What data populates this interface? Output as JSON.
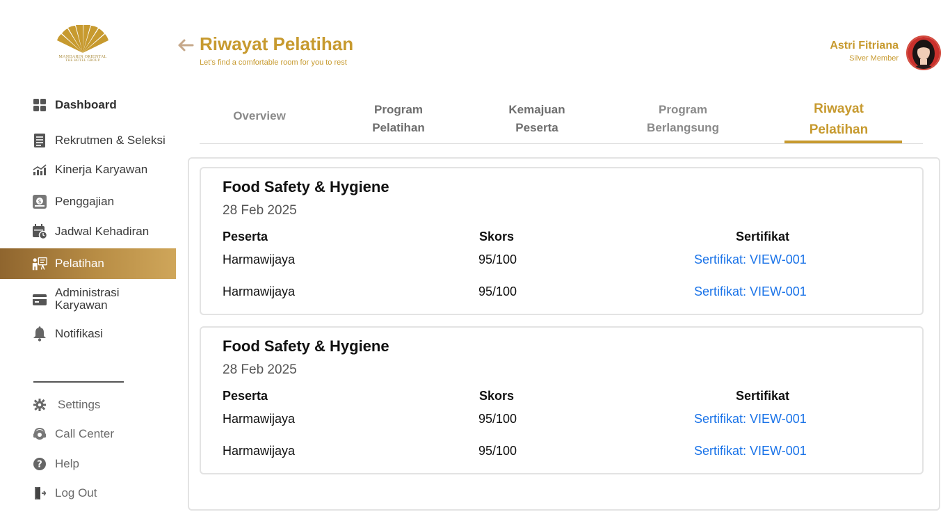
{
  "brand": {
    "line1": "MANDARIN ORIENTAL",
    "line2": "THE HOTEL GROUP",
    "color": "#c79a2f"
  },
  "sidebar": {
    "items": [
      {
        "label": "Dashboard",
        "icon": "grid-icon"
      },
      {
        "label": "Rekrutmen & Seleksi",
        "icon": "clipboard-icon"
      },
      {
        "label": "Kinerja Karyawan",
        "icon": "chart-icon"
      },
      {
        "label": "Penggajian",
        "icon": "payroll-icon"
      },
      {
        "label": "Jadwal Kehadiran",
        "icon": "calendar-icon"
      },
      {
        "label": "Pelatihan",
        "icon": "training-icon"
      },
      {
        "label_1": "Administrasi",
        "label_2": "Karyawan",
        "icon": "card-icon"
      },
      {
        "label": "Notifikasi",
        "icon": "bell-icon"
      }
    ],
    "bottom": [
      {
        "label": "Settings",
        "icon": "gear-icon"
      },
      {
        "label": "Call Center",
        "icon": "headset-icon"
      },
      {
        "label": "Help",
        "icon": "help-icon"
      },
      {
        "label": "Log Out",
        "icon": "logout-icon"
      }
    ],
    "active_gradient": [
      "#8f652e",
      "#cfa65a"
    ]
  },
  "header": {
    "title": "Riwayat Pelatihan",
    "subtitle": "Let's find a comfortable room for you to rest",
    "user_name": "Astri Fitriana",
    "user_tier": "Silver Member"
  },
  "tabs": [
    {
      "l1": "Overview",
      "l2": ""
    },
    {
      "l1": "Program",
      "l2": "Pelatihan"
    },
    {
      "l1": "Kemajuan",
      "l2": "Peserta"
    },
    {
      "l1": "Program",
      "l2": "Berlangsung"
    },
    {
      "l1": "Riwayat",
      "l2": "Pelatihan"
    }
  ],
  "cards": [
    {
      "title": "Food Safety & Hygiene",
      "date": "28 Feb 2025",
      "headers": {
        "peserta": "Peserta",
        "skors": "Skors",
        "sertifikat": "Sertifikat"
      },
      "rows": [
        {
          "peserta": "Harmawijaya",
          "skors": "95/100",
          "sertifikat": "Sertifikat: VIEW-001"
        },
        {
          "peserta": "Harmawijaya",
          "skors": "95/100",
          "sertifikat": "Sertifikat: VIEW-001"
        }
      ]
    },
    {
      "title": "Food Safety & Hygiene",
      "date": "28 Feb 2025",
      "headers": {
        "peserta": "Peserta",
        "skors": "Skors",
        "sertifikat": "Sertifikat"
      },
      "rows": [
        {
          "peserta": "Harmawijaya",
          "skors": "95/100",
          "sertifikat": "Sertifikat: VIEW-001"
        },
        {
          "peserta": "Harmawijaya",
          "skors": "95/100",
          "sertifikat": "Sertifikat: VIEW-001"
        }
      ]
    }
  ],
  "colors": {
    "accent": "#c79a2f",
    "link": "#1a73e8"
  }
}
